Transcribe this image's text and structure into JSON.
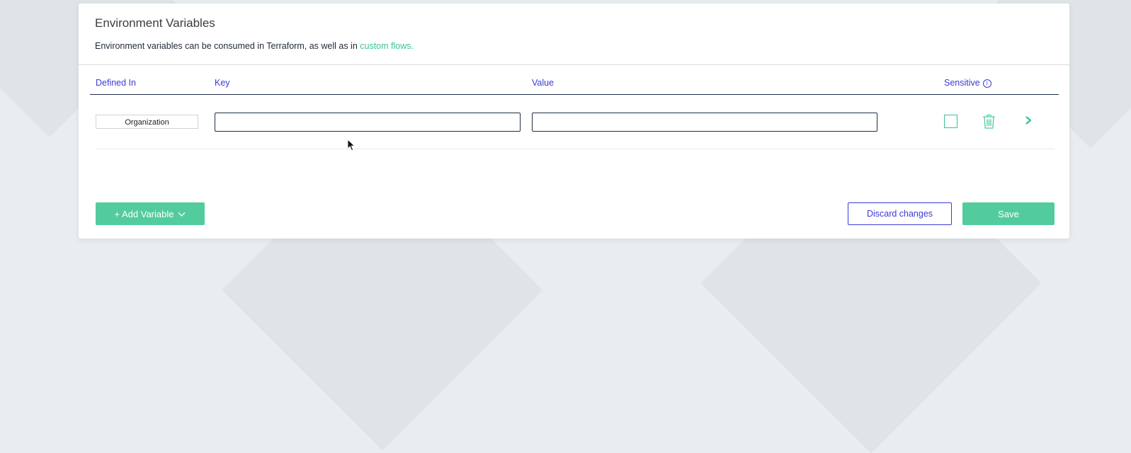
{
  "panel": {
    "title": "Environment Variables",
    "description_prefix": "Environment variables can be consumed in Terraform, as well as in ",
    "description_link": "custom flows."
  },
  "table": {
    "headers": {
      "defined_in": "Defined In",
      "key": "Key",
      "value": "Value",
      "sensitive": "Sensitive"
    },
    "rows": [
      {
        "defined_in": "Organization",
        "key": "",
        "value": "",
        "sensitive": false
      }
    ]
  },
  "actions": {
    "add_variable": "+ Add Variable",
    "discard": "Discard changes",
    "save": "Save"
  },
  "icons": {
    "info": "info-icon",
    "trash": "trash-icon",
    "chevron": "chevron-right-icon",
    "caret": "chevron-down-icon"
  },
  "colors": {
    "accent_green": "#52cc9d",
    "link_green": "#3cc28f",
    "accent_blue": "#3b3bd6",
    "background": "#e9edef"
  }
}
